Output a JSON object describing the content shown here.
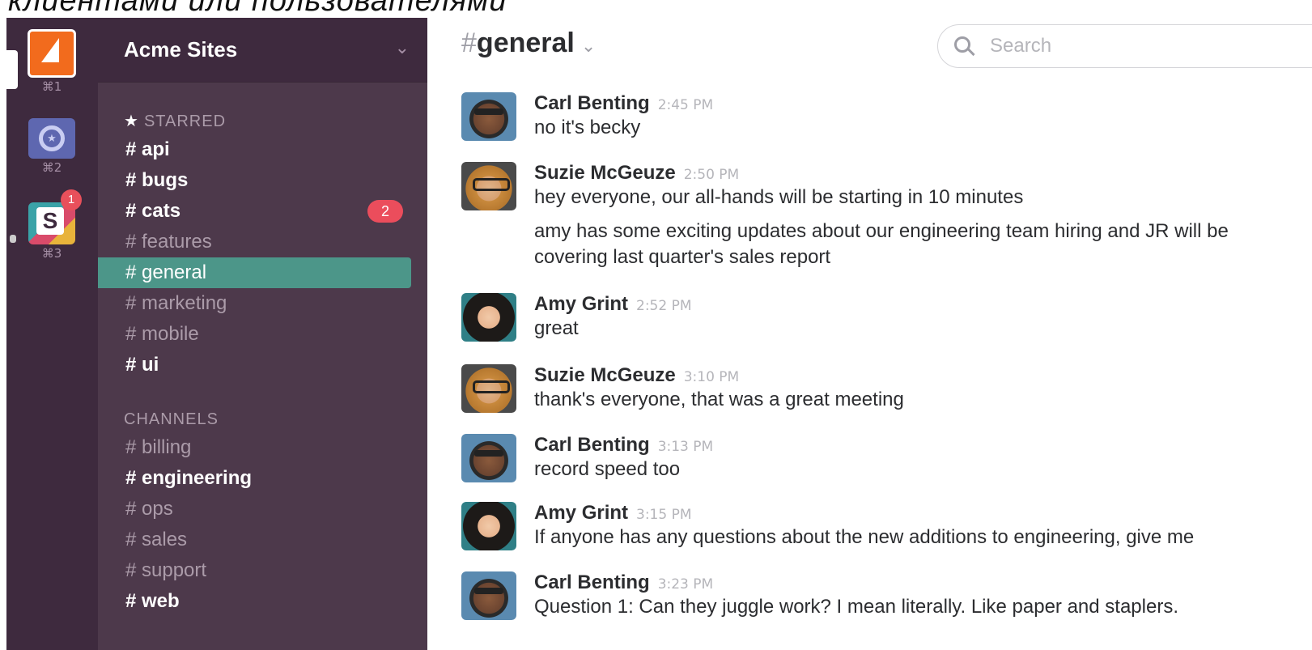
{
  "caption": "клиентами или пользователями",
  "teams": [
    {
      "shortcut": "⌘1",
      "icon": "team-acme-icon"
    },
    {
      "shortcut": "⌘2",
      "icon": "team-star-icon"
    },
    {
      "shortcut": "⌘3",
      "icon": "team-s-icon",
      "letter": "S",
      "badge": "1"
    }
  ],
  "team": {
    "name": "Acme Sites"
  },
  "starred": {
    "title": "STARRED",
    "channels": [
      {
        "label": "# api",
        "bold": true
      },
      {
        "label": "# bugs",
        "bold": true
      },
      {
        "label": "# cats",
        "bold": true,
        "unread": "2"
      },
      {
        "label": "# features",
        "bold": false
      },
      {
        "label": "# general",
        "bold": false,
        "active": true
      },
      {
        "label": "# marketing",
        "bold": false
      },
      {
        "label": "# mobile",
        "bold": false
      },
      {
        "label": "# ui",
        "bold": true
      }
    ]
  },
  "channels_section": {
    "title": "CHANNELS",
    "channels": [
      {
        "label": "# billing",
        "bold": false
      },
      {
        "label": "# engineering",
        "bold": true
      },
      {
        "label": "# ops",
        "bold": false
      },
      {
        "label": "# sales",
        "bold": false
      },
      {
        "label": "# support",
        "bold": false
      },
      {
        "label": "# web",
        "bold": true
      }
    ]
  },
  "header": {
    "hash": "#",
    "channel": "general",
    "chevron": "⌄"
  },
  "search": {
    "placeholder": "Search"
  },
  "messages": [
    {
      "author": "Carl Benting",
      "time": "2:45 PM",
      "avatar": "carl",
      "lines": [
        "no it's becky"
      ]
    },
    {
      "author": "Suzie McGeuze",
      "time": "2:50 PM",
      "avatar": "suzie",
      "lines": [
        "hey everyone, our all-hands will be starting in 10 minutes",
        "amy has some exciting updates about our engineering team hiring and JR will be covering last quarter's sales report"
      ]
    },
    {
      "author": "Amy Grint",
      "time": "2:52 PM",
      "avatar": "amy",
      "lines": [
        "great"
      ]
    },
    {
      "author": "Suzie McGeuze",
      "time": "3:10 PM",
      "avatar": "suzie",
      "lines": [
        "thank's everyone, that was a great meeting"
      ]
    },
    {
      "author": "Carl Benting",
      "time": "3:13 PM",
      "avatar": "carl",
      "lines": [
        "record speed too"
      ]
    },
    {
      "author": "Amy Grint",
      "time": "3:15 PM",
      "avatar": "amy",
      "lines": [
        "If anyone has any questions about the new additions to engineering, give me"
      ]
    },
    {
      "author": "Carl Benting",
      "time": "3:23 PM",
      "avatar": "carl",
      "lines": [
        "Question 1: Can they juggle work? I mean literally. Like paper and staplers."
      ]
    }
  ]
}
